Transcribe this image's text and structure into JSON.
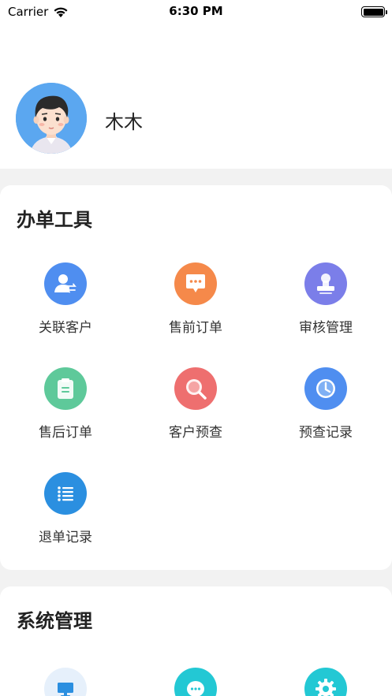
{
  "status_bar": {
    "carrier": "Carrier",
    "time": "6:30 PM"
  },
  "profile": {
    "name": "木木"
  },
  "tools": {
    "title": "办单工具",
    "items": [
      {
        "label": "关联客户",
        "icon": "link-customer-icon",
        "color": "#4f8ef0"
      },
      {
        "label": "售前订单",
        "icon": "chat-bubble-icon",
        "color": "#f5894a"
      },
      {
        "label": "审核管理",
        "icon": "stamp-icon",
        "color": "#7b7ee9"
      },
      {
        "label": "售后订单",
        "icon": "clipboard-icon",
        "color": "#5ec99a"
      },
      {
        "label": "客户预查",
        "icon": "search-icon",
        "color": "#ee6f6f"
      },
      {
        "label": "预查记录",
        "icon": "clock-icon",
        "color": "#4f8ef0"
      },
      {
        "label": "退单记录",
        "icon": "list-icon",
        "color": "#2b8fe0"
      }
    ]
  },
  "system": {
    "title": "系统管理",
    "items": [
      {
        "icon": "monitor-icon",
        "color": "#e6f0fb"
      },
      {
        "icon": "message-icon",
        "color": "#23c8d4"
      },
      {
        "icon": "gear-icon",
        "color": "#23c8d4"
      }
    ]
  }
}
